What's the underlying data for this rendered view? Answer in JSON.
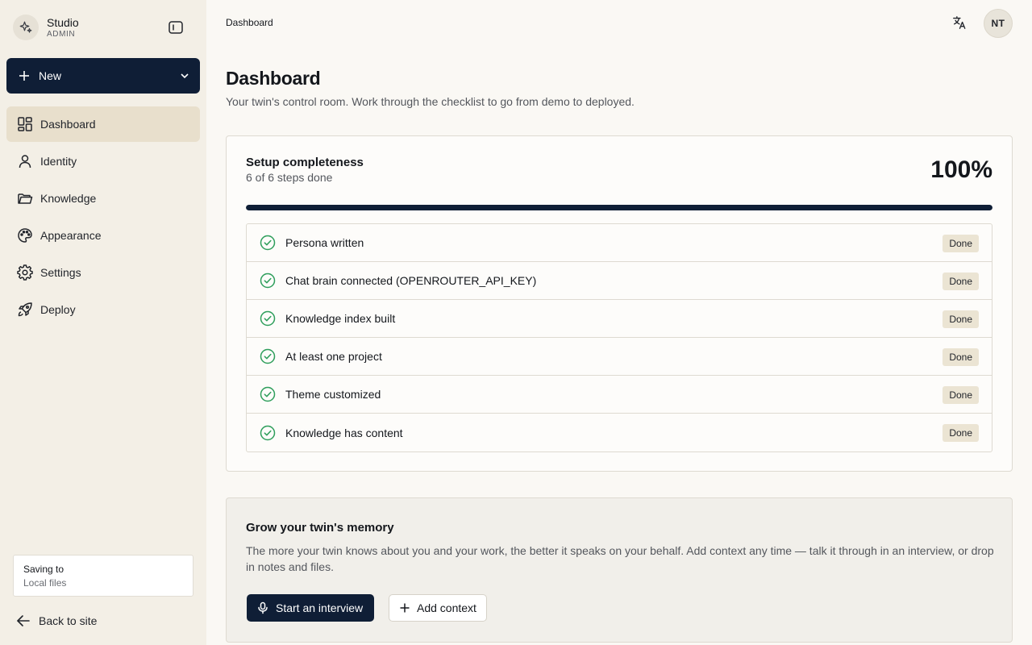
{
  "sidebar": {
    "brand_name": "Studio",
    "brand_role": "ADMIN",
    "new_label": "New",
    "items": [
      {
        "label": "Dashboard",
        "icon": "layout-grid-icon",
        "active": true
      },
      {
        "label": "Identity",
        "icon": "user-icon"
      },
      {
        "label": "Knowledge",
        "icon": "folder-icon"
      },
      {
        "label": "Appearance",
        "icon": "palette-icon"
      },
      {
        "label": "Settings",
        "icon": "gear-icon"
      },
      {
        "label": "Deploy",
        "icon": "rocket-icon"
      }
    ],
    "saving_title": "Saving to",
    "saving_value": "Local files",
    "back_label": "Back to site"
  },
  "topbar": {
    "breadcrumb": "Dashboard",
    "avatar_initials": "NT"
  },
  "main": {
    "title": "Dashboard",
    "subtitle": "Your twin's control room. Work through the checklist to go from demo to deployed."
  },
  "setup": {
    "title": "Setup completeness",
    "subtitle": "6 of 6 steps done",
    "percent_label": "100%",
    "progress": 1.0,
    "steps": [
      {
        "label": "Persona written",
        "status": "Done"
      },
      {
        "label": "Chat brain connected (OPENROUTER_API_KEY)",
        "status": "Done"
      },
      {
        "label": "Knowledge index built",
        "status": "Done"
      },
      {
        "label": "At least one project",
        "status": "Done"
      },
      {
        "label": "Theme customized",
        "status": "Done"
      },
      {
        "label": "Knowledge has content",
        "status": "Done"
      }
    ]
  },
  "grow": {
    "title": "Grow your twin's memory",
    "body": "The more your twin knows about you and your work, the better it speaks on your behalf. Add context any time — talk it through in an interview, or drop in notes and files.",
    "primary_label": "Start an interview",
    "secondary_label": "Add context"
  },
  "colors": {
    "accent": "#0f1e36",
    "active_nav": "#e8dfcc",
    "success": "#2e9e5b",
    "background": "#faf8f4",
    "sidebar": "#f3efe6"
  }
}
